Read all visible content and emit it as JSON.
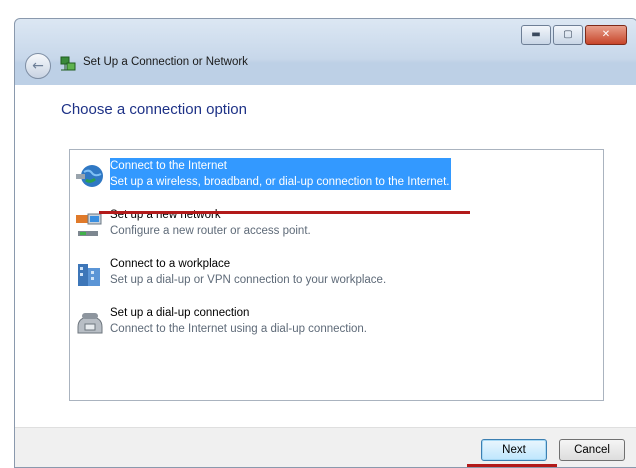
{
  "window": {
    "title": "Set Up a Connection or Network",
    "controls": [
      "minimize",
      "maximize",
      "close"
    ]
  },
  "main": {
    "heading": "Choose a connection option",
    "options": [
      {
        "title": "Connect to the Internet",
        "desc": "Set up a wireless, broadband, or dial-up connection to the Internet.",
        "icon": "globe-icon",
        "selected": true
      },
      {
        "title": "Set up a new network",
        "desc": "Configure a new router or access point.",
        "icon": "network-icon",
        "selected": false
      },
      {
        "title": "Connect to a workplace",
        "desc": "Set up a dial-up or VPN connection to your workplace.",
        "icon": "workplace-icon",
        "selected": false
      },
      {
        "title": "Set up a dial-up connection",
        "desc": "Connect to the Internet using a dial-up connection.",
        "icon": "phone-icon",
        "selected": false
      }
    ]
  },
  "footer": {
    "next_label": "Next",
    "cancel_label": "Cancel"
  },
  "colors": {
    "selection": "#3399ff",
    "heading": "#1e3287",
    "annotation": "#b21a1a"
  }
}
